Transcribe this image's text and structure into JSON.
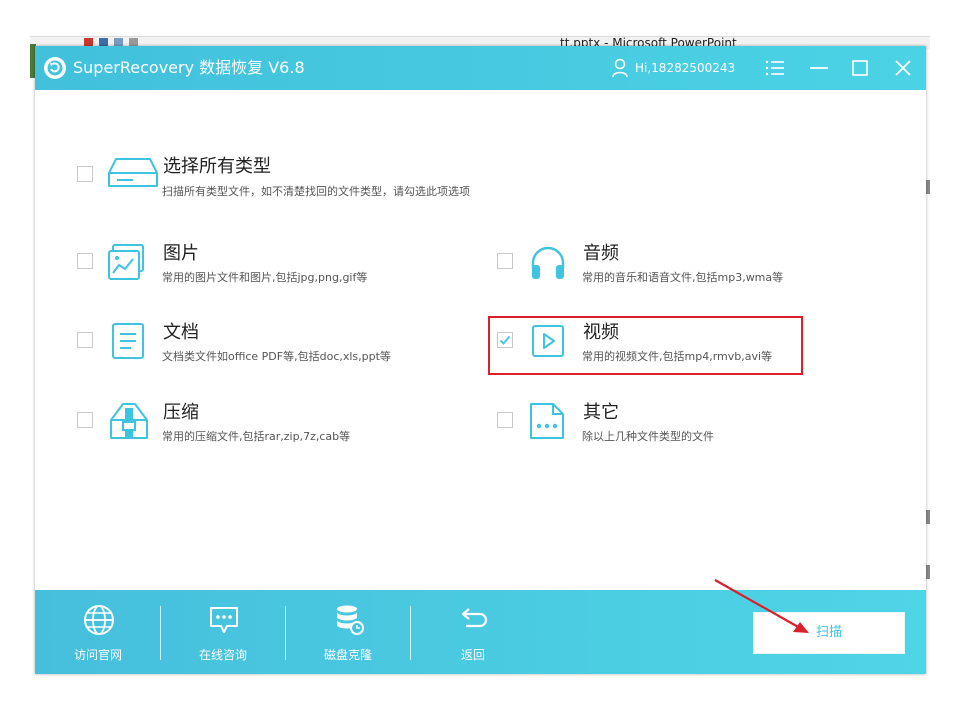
{
  "background": {
    "window_title": "tt.pptx - Microsoft PowerPoint"
  },
  "app": {
    "title": "SuperRecovery 数据恢复 V6.8",
    "user": "Hi,18282500243",
    "accent_color": "#46c8e2",
    "icons": {
      "logo": "superrecovery-logo",
      "user": "user-icon",
      "menu": "menu-icon",
      "minimize": "minimize-icon",
      "maximize": "maximize-icon",
      "close": "close-icon"
    }
  },
  "options": {
    "all": {
      "label": "选择所有类型",
      "desc": "扫描所有类型文件，如不清楚找回的文件类型，请勾选此项选项",
      "checked": false,
      "icon": "hard-drive-icon"
    },
    "image": {
      "label": "图片",
      "desc": "常用的图片文件和图片,包括jpg,png,gif等",
      "checked": false,
      "icon": "image-icon"
    },
    "audio": {
      "label": "音频",
      "desc": "常用的音乐和语音文件,包括mp3,wma等",
      "checked": false,
      "icon": "headphones-icon"
    },
    "document": {
      "label": "文档",
      "desc": "文档类文件如office PDF等,包括doc,xls,ppt等",
      "checked": false,
      "icon": "document-icon"
    },
    "video": {
      "label": "视频",
      "desc": "常用的视频文件,包括mp4,rmvb,avi等",
      "checked": true,
      "icon": "video-play-icon"
    },
    "archive": {
      "label": "压缩",
      "desc": "常用的压缩文件,包括rar,zip,7z,cab等",
      "checked": false,
      "icon": "archive-icon"
    },
    "other": {
      "label": "其它",
      "desc": "除以上几种文件类型的文件",
      "checked": false,
      "icon": "more-file-icon"
    }
  },
  "footer": {
    "website": "访问官网",
    "consult": "在线咨询",
    "clone": "磁盘克隆",
    "back": "返回",
    "scan": "扫描"
  },
  "annotation_color": "#d9202b"
}
